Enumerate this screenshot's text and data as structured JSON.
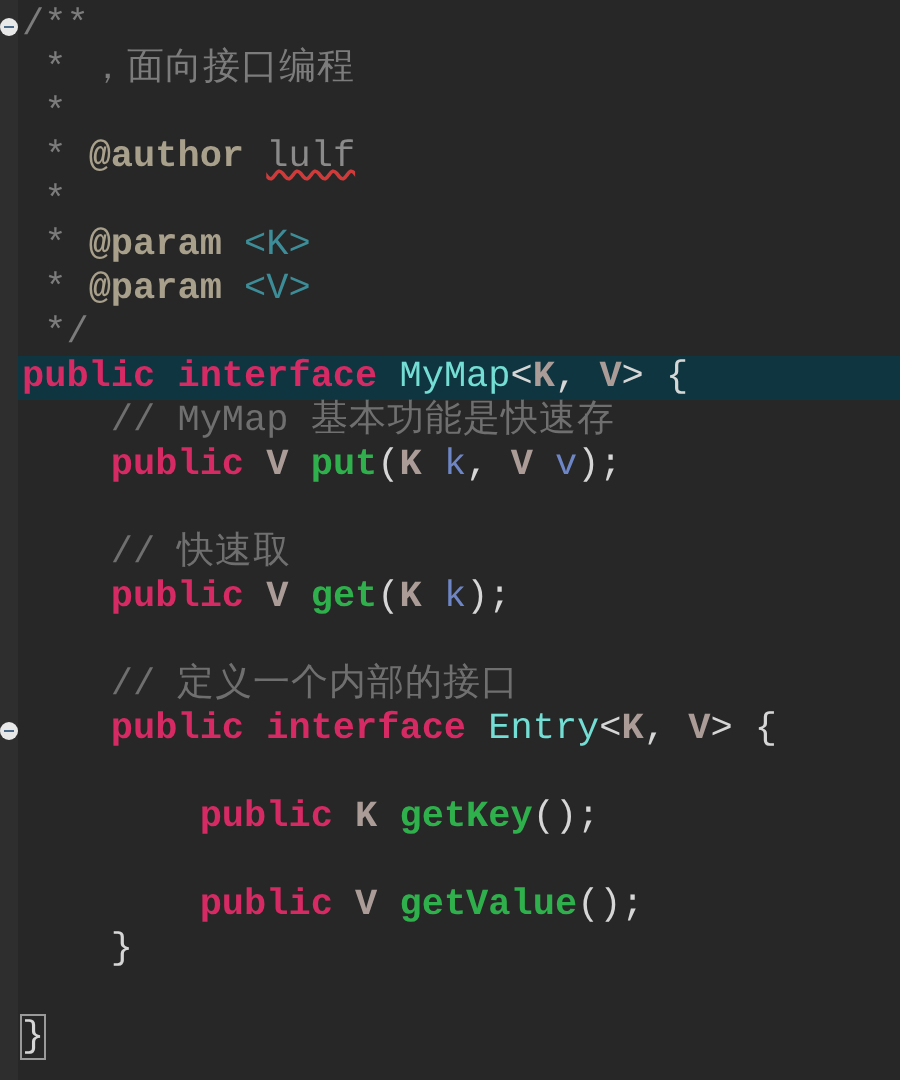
{
  "editor": {
    "lines": [
      {
        "fold": true,
        "current": false,
        "tokens": [
          {
            "kind": "doc",
            "text": "/**"
          }
        ]
      },
      {
        "fold": false,
        "current": false,
        "tokens": [
          {
            "kind": "doc",
            "text": " * ，面向接口编程"
          }
        ]
      },
      {
        "fold": false,
        "current": false,
        "tokens": [
          {
            "kind": "doc",
            "text": " *"
          }
        ]
      },
      {
        "fold": false,
        "current": false,
        "tokens": [
          {
            "kind": "doc",
            "text": " * "
          },
          {
            "kind": "doctag",
            "text": "@author "
          },
          {
            "kind": "misspelled",
            "text": "lulf"
          }
        ]
      },
      {
        "fold": false,
        "current": false,
        "tokens": [
          {
            "kind": "doc",
            "text": " *"
          }
        ]
      },
      {
        "fold": false,
        "current": false,
        "tokens": [
          {
            "kind": "doc",
            "text": " * "
          },
          {
            "kind": "doctag",
            "text": "@param "
          },
          {
            "kind": "docparam",
            "text": "<K>"
          }
        ]
      },
      {
        "fold": false,
        "current": false,
        "tokens": [
          {
            "kind": "doc",
            "text": " * "
          },
          {
            "kind": "doctag",
            "text": "@param "
          },
          {
            "kind": "docparam",
            "text": "<V>"
          }
        ]
      },
      {
        "fold": false,
        "current": false,
        "tokens": [
          {
            "kind": "doc",
            "text": " */"
          }
        ]
      },
      {
        "fold": false,
        "current": true,
        "tokens": [
          {
            "kind": "keyword",
            "text": "public interface "
          },
          {
            "kind": "class",
            "text": "MyMap"
          },
          {
            "kind": "plain",
            "text": "<"
          },
          {
            "kind": "type",
            "text": "K"
          },
          {
            "kind": "plain",
            "text": ", "
          },
          {
            "kind": "type",
            "text": "V"
          },
          {
            "kind": "plain",
            "text": "> {"
          }
        ]
      },
      {
        "fold": false,
        "current": false,
        "tokens": [
          {
            "kind": "comment",
            "text": "    // MyMap 基本功能是快速存"
          }
        ]
      },
      {
        "fold": false,
        "current": false,
        "tokens": [
          {
            "kind": "keyword",
            "text": "    public "
          },
          {
            "kind": "type",
            "text": "V "
          },
          {
            "kind": "method",
            "text": "put"
          },
          {
            "kind": "plain",
            "text": "("
          },
          {
            "kind": "type",
            "text": "K "
          },
          {
            "kind": "param",
            "text": "k"
          },
          {
            "kind": "plain",
            "text": ", "
          },
          {
            "kind": "type",
            "text": "V "
          },
          {
            "kind": "param",
            "text": "v"
          },
          {
            "kind": "plain",
            "text": ");"
          }
        ]
      },
      {
        "fold": false,
        "current": false
      },
      {
        "fold": false,
        "current": false,
        "tokens": [
          {
            "kind": "comment",
            "text": "    // 快速取"
          }
        ]
      },
      {
        "fold": false,
        "current": false,
        "tokens": [
          {
            "kind": "keyword",
            "text": "    public "
          },
          {
            "kind": "type",
            "text": "V "
          },
          {
            "kind": "method",
            "text": "get"
          },
          {
            "kind": "plain",
            "text": "("
          },
          {
            "kind": "type",
            "text": "K "
          },
          {
            "kind": "param",
            "text": "k"
          },
          {
            "kind": "plain",
            "text": ");"
          }
        ]
      },
      {
        "fold": false,
        "current": false
      },
      {
        "fold": false,
        "current": false,
        "tokens": [
          {
            "kind": "comment",
            "text": "    // 定义一个内部的接口"
          }
        ]
      },
      {
        "fold": true,
        "current": false,
        "tokens": [
          {
            "kind": "keyword",
            "text": "    public interface "
          },
          {
            "kind": "class",
            "text": "Entry"
          },
          {
            "kind": "plain",
            "text": "<"
          },
          {
            "kind": "type",
            "text": "K"
          },
          {
            "kind": "plain",
            "text": ", "
          },
          {
            "kind": "type",
            "text": "V"
          },
          {
            "kind": "plain",
            "text": "> {"
          }
        ]
      },
      {
        "fold": false,
        "current": false
      },
      {
        "fold": false,
        "current": false,
        "tokens": [
          {
            "kind": "keyword",
            "text": "        public "
          },
          {
            "kind": "type",
            "text": "K "
          },
          {
            "kind": "method",
            "text": "getKey"
          },
          {
            "kind": "plain",
            "text": "();"
          }
        ]
      },
      {
        "fold": false,
        "current": false
      },
      {
        "fold": false,
        "current": false,
        "tokens": [
          {
            "kind": "keyword",
            "text": "        public "
          },
          {
            "kind": "type",
            "text": "V "
          },
          {
            "kind": "method",
            "text": "getValue"
          },
          {
            "kind": "plain",
            "text": "();"
          }
        ]
      },
      {
        "fold": false,
        "current": false,
        "tokens": [
          {
            "kind": "plain",
            "text": "    }"
          }
        ]
      },
      {
        "fold": false,
        "current": false
      },
      {
        "fold": false,
        "current": false,
        "tokens": [
          {
            "kind": "matched-brace",
            "text": "}"
          }
        ]
      }
    ]
  }
}
